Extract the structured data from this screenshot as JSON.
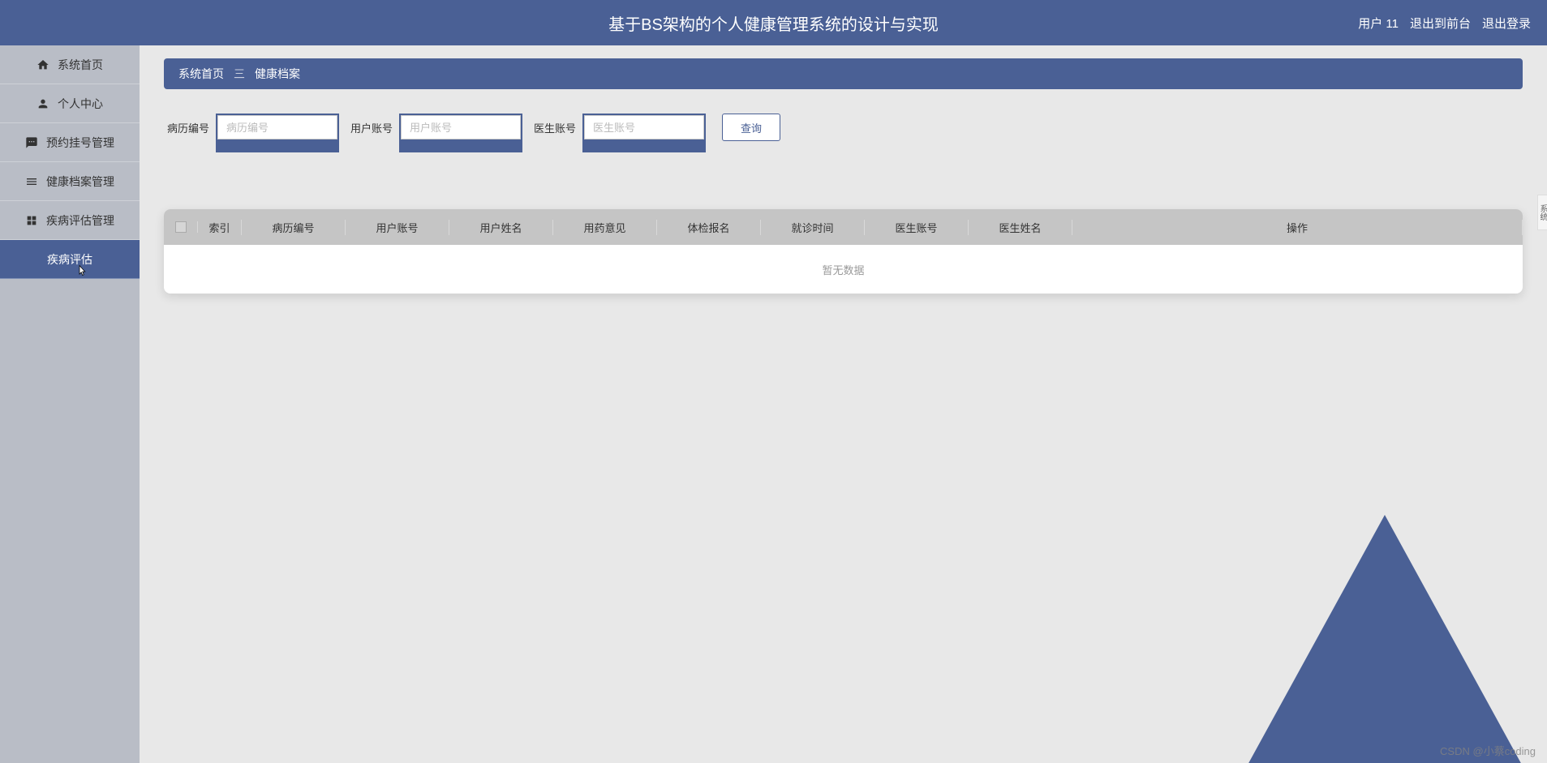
{
  "header": {
    "title": "基于BS架构的个人健康管理系统的设计与实现",
    "user_label": "用户 11",
    "logout_front": "退出到前台",
    "logout": "退出登录"
  },
  "sidebar": {
    "items": [
      {
        "icon": "home",
        "label": "系统首页"
      },
      {
        "icon": "person",
        "label": "个人中心"
      },
      {
        "icon": "sms",
        "label": "预约挂号管理"
      },
      {
        "icon": "list",
        "label": "健康档案管理"
      },
      {
        "icon": "grid",
        "label": "疾病评估管理"
      },
      {
        "icon": "",
        "label": "疾病评估",
        "active": true
      }
    ]
  },
  "breadcrumb": {
    "home": "系统首页",
    "sep": "三",
    "current": "健康档案"
  },
  "search": {
    "field1_label": "病历编号",
    "field1_placeholder": "病历编号",
    "field2_label": "用户账号",
    "field2_placeholder": "用户账号",
    "field3_label": "医生账号",
    "field3_placeholder": "医生账号",
    "button": "查询"
  },
  "table": {
    "headers": {
      "index": "索引",
      "col1": "病历编号",
      "col2": "用户账号",
      "col3": "用户姓名",
      "col4": "用药意见",
      "col5": "体检报名",
      "col6": "就诊时间",
      "col7": "医生账号",
      "col8": "医生姓名",
      "op": "操作"
    },
    "empty": "暂无数据"
  },
  "watermark": "CSDN @小蔡coding",
  "side_tab": "系统"
}
